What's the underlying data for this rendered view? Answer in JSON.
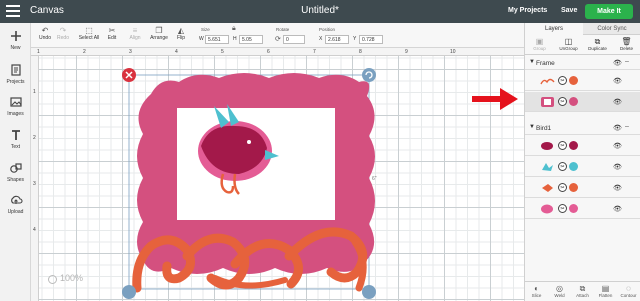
{
  "header": {
    "app_title": "Canvas",
    "document_title": "Untitled*",
    "my_projects": "My Projects",
    "save": "Save",
    "make_it": "Make It"
  },
  "left_nav": [
    {
      "label": "New",
      "icon": "plus-icon"
    },
    {
      "label": "Projects",
      "icon": "projects-icon"
    },
    {
      "label": "Images",
      "icon": "images-icon"
    },
    {
      "label": "Text",
      "icon": "text-icon"
    },
    {
      "label": "Shapes",
      "icon": "shapes-icon"
    },
    {
      "label": "Upload",
      "icon": "upload-icon"
    }
  ],
  "toolbar": {
    "undo": "Undo",
    "redo": "Redo",
    "select_all": "Select All",
    "edit": "Edit",
    "align": "Align",
    "arrange": "Arrange",
    "flip": "Flip",
    "size_label": "Size",
    "w_key": "W",
    "h_key": "H",
    "width": "5.651",
    "height": "5.05",
    "rotate_label": "Rotate",
    "rotate": "0",
    "position_label": "Position",
    "x_key": "X",
    "y_key": "Y",
    "x": "2.618",
    "y": "0.728"
  },
  "rulers": {
    "top": [
      "1",
      "2",
      "3",
      "4",
      "5",
      "6",
      "7",
      "8",
      "9",
      "10"
    ],
    "left": [
      "1",
      "2",
      "3",
      "4"
    ]
  },
  "canvas": {
    "zoom": "100%",
    "height_indicator": "6\""
  },
  "layers_panel": {
    "tabs": [
      "Layers",
      "Color Sync"
    ],
    "tools": [
      "Group",
      "UnGroup",
      "Duplicate",
      "Delete"
    ],
    "groups": [
      {
        "name": "Frame",
        "layers": [
          {
            "color": "#e6623c",
            "thumb": "frame-swirl-thumbnail",
            "selected": false
          },
          {
            "color": "#d4507f",
            "thumb": "frame-thumbnail",
            "selected": true
          }
        ]
      },
      {
        "name": "Bird1",
        "layers": [
          {
            "color": "#a3194a",
            "thumb": "bird-body-thumbnail",
            "selected": false
          },
          {
            "color": "#4ec0cf",
            "thumb": "bird-wing-thumbnail",
            "selected": false
          },
          {
            "color": "#e6623c",
            "thumb": "bird-feet-thumbnail",
            "selected": false
          },
          {
            "color": "#e45c95",
            "thumb": "bird-outline-thumbnail",
            "selected": false
          }
        ]
      }
    ],
    "bottom_tools": [
      "Slice",
      "Weld",
      "Attach",
      "Flatten",
      "Contour"
    ]
  },
  "colors": {
    "header_bg": "#3e4a4f",
    "make_it": "#2bb24c",
    "frame_pink": "#d4507f",
    "swirl_orange": "#e6623c",
    "bird_body": "#a3194a",
    "bird_teal": "#4ec0cf",
    "arrow_red": "#e5121c"
  }
}
